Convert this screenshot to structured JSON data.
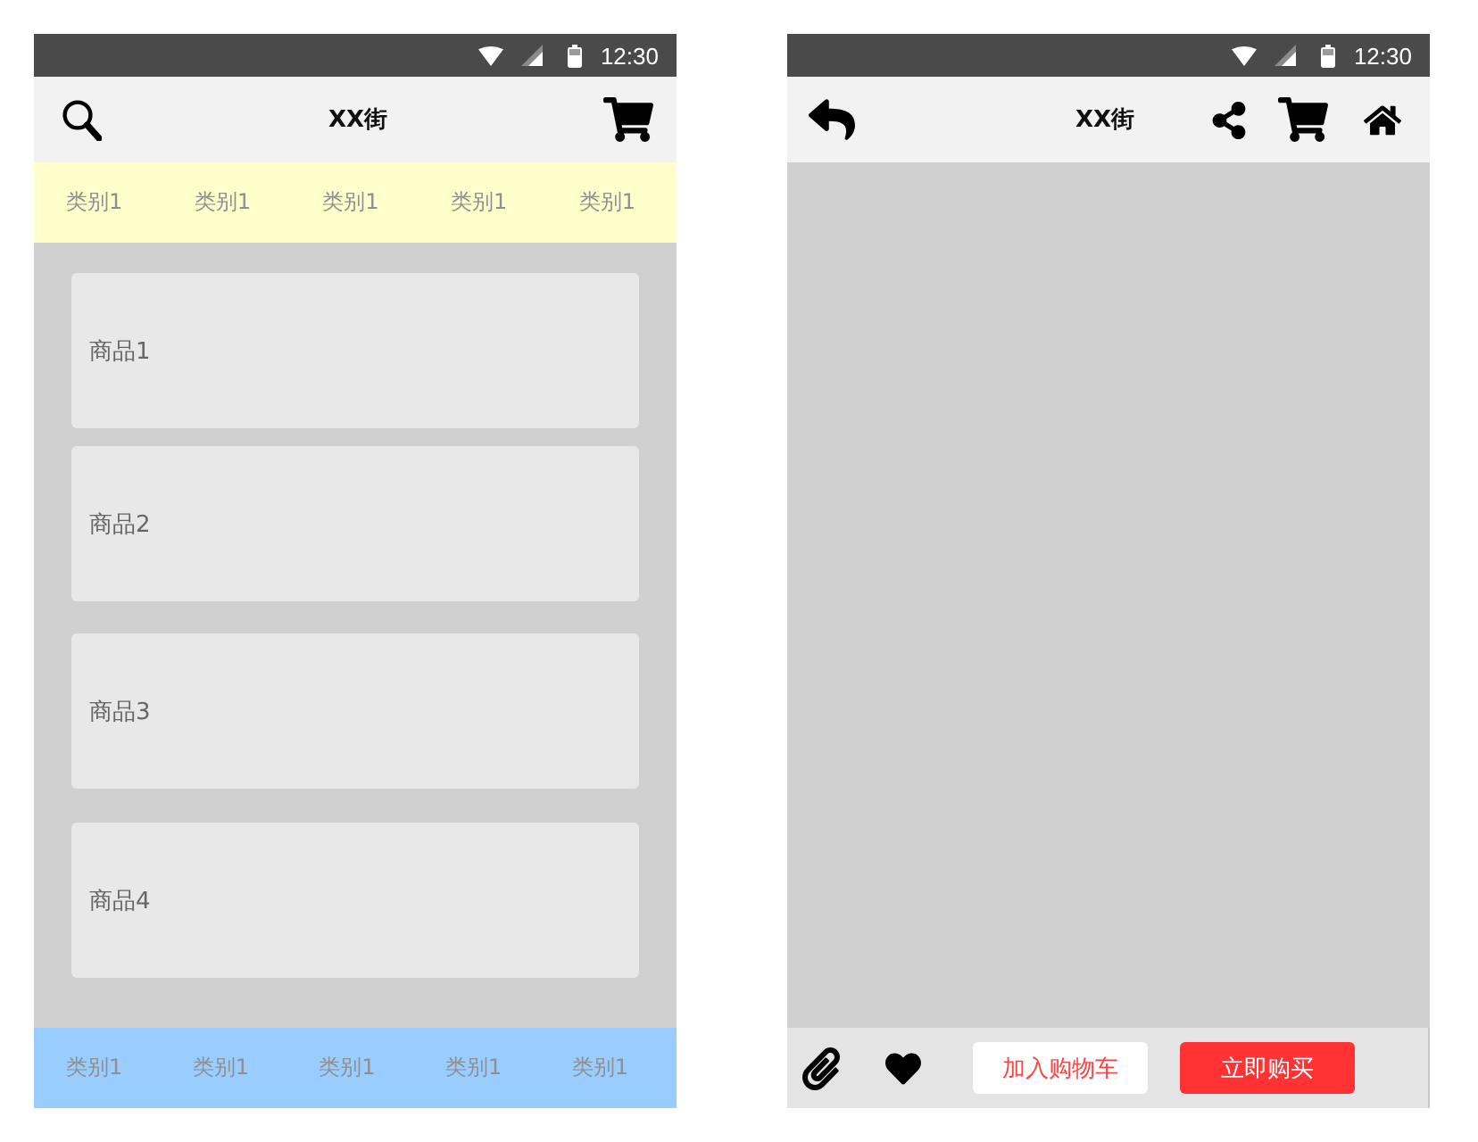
{
  "list_screen": {
    "status_bar": {
      "time": "12:30"
    },
    "header": {
      "title": "XX街"
    },
    "category_bar": [
      {
        "label": "类别1"
      },
      {
        "label": "类别1"
      },
      {
        "label": "类别1"
      },
      {
        "label": "类别1"
      },
      {
        "label": "类别1"
      }
    ],
    "products": [
      {
        "name": "商品1"
      },
      {
        "name": "商品2"
      },
      {
        "name": "商品3"
      },
      {
        "name": "商品4"
      }
    ],
    "bottom_bar": [
      {
        "label": "类别1"
      },
      {
        "label": "类别1"
      },
      {
        "label": "类别1"
      },
      {
        "label": "类别1"
      },
      {
        "label": "类别1"
      }
    ]
  },
  "detail_screen": {
    "status_bar": {
      "time": "12:30"
    },
    "header": {
      "title": "XX街"
    },
    "action_bar": {
      "buttons": [
        {
          "label": "加入购物车",
          "kind": "secondary"
        },
        {
          "label": "立即购买",
          "kind": "primary"
        }
      ]
    }
  }
}
